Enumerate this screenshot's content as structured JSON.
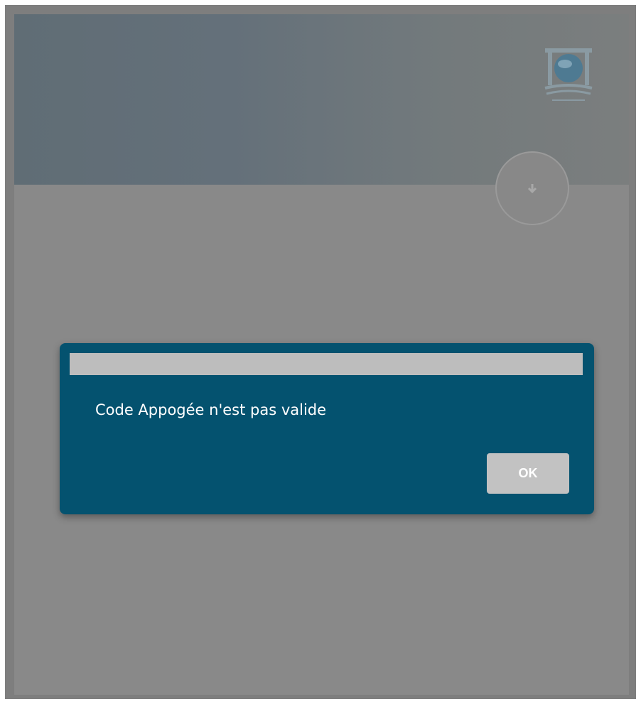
{
  "banner": {
    "logo_icon": "university-globe-logo",
    "action_icon": "arrow-down-icon"
  },
  "dialog": {
    "title": "",
    "message": "Code Appogée n'est pas valide",
    "ok_label": "OK"
  },
  "colors": {
    "dialog_background": "#04526f",
    "overlay_gray": "#898989",
    "titlebar_gray": "#bdbdbd",
    "button_gray": "#c2c2c2"
  }
}
